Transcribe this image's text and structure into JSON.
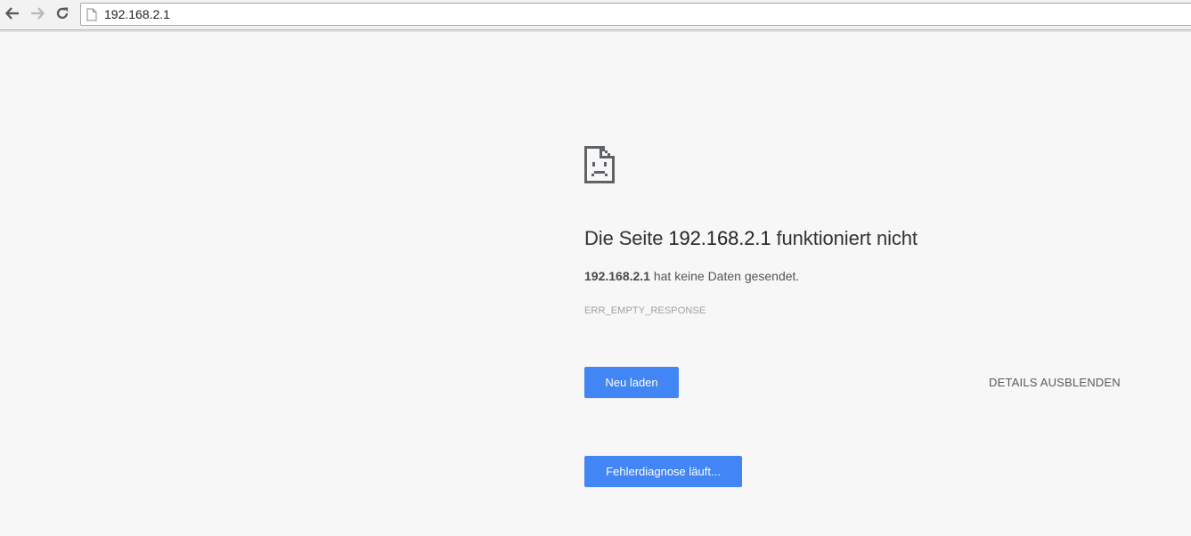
{
  "browser": {
    "url": "192.168.2.1",
    "icons": {
      "back": "arrow-left-icon",
      "forward": "arrow-right-icon",
      "reload": "reload-icon",
      "page": "page-icon"
    }
  },
  "error_page": {
    "icon": "sad-page-icon",
    "heading_prefix": "Die Seite ",
    "heading_host": "192.168.2.1",
    "heading_suffix": " funktioniert nicht",
    "desc_host": "192.168.2.1",
    "desc_suffix": " hat keine Daten gesendet.",
    "error_code": "ERR_EMPTY_RESPONSE",
    "reload_label": "Neu laden",
    "details_label": "DETAILS AUSBLENDEN",
    "diagnose_label": "Fehlerdiagnose läuft..."
  },
  "colors": {
    "button_blue": "#4285f4",
    "page_background": "#f7f7f7"
  }
}
